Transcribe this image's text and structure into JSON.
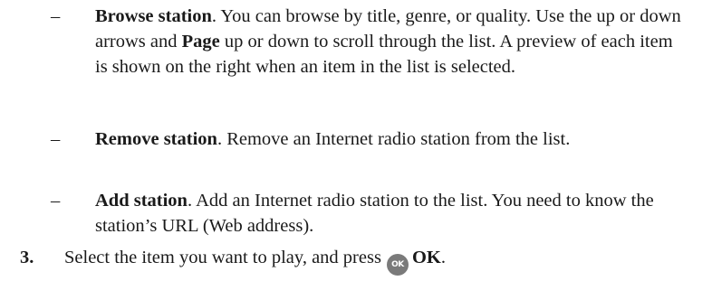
{
  "bullets": [
    {
      "marker": "–",
      "title": "Browse station",
      "text_1": ". You can browse by title, genre, or quality. Use the up or down arrows and ",
      "key_word": "Page",
      "text_2": " up or down to scroll through the list. A preview of each item is shown on the right when an item in the list is selected."
    },
    {
      "marker": "–",
      "title": "Remove station",
      "text": ". Remove an Internet radio station from the list."
    },
    {
      "marker": "–",
      "title": "Add station",
      "text": ". Add an Internet radio station to the list. You need to know the station’s URL (Web address)."
    }
  ],
  "step": {
    "number": "3.",
    "text": "Select the item you want to play, and press",
    "icon_label": "OK",
    "icon_name": "ok-button-icon",
    "button_label": "OK",
    "end": "."
  }
}
